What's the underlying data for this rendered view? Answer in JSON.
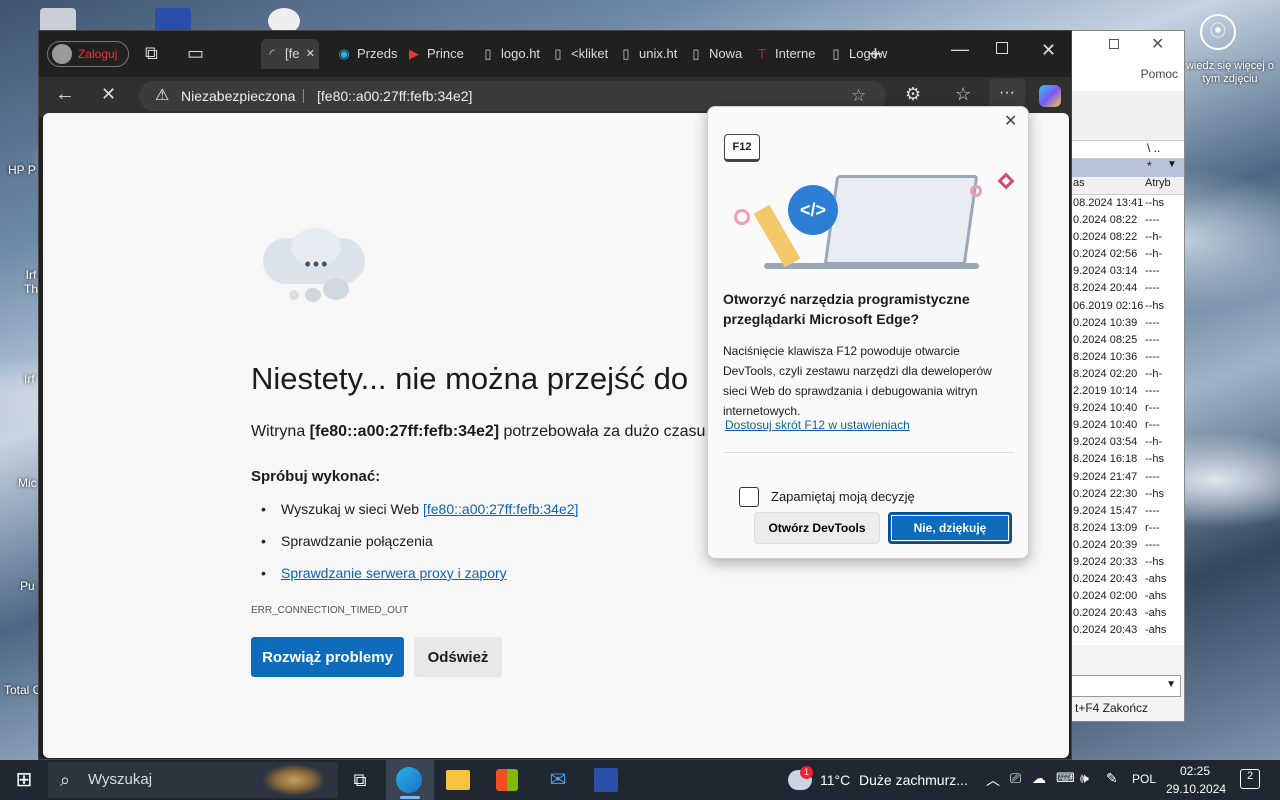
{
  "desktop": {
    "icons": [
      "HP P",
      "Irf Th",
      "Irf",
      "Mic",
      "Pu",
      "Total C"
    ],
    "overlay_text": "wiedz się więcej o tym zdjęciu"
  },
  "back_window": {
    "menu_help": "Pomoc",
    "path_hint": "\\ ..",
    "filter": "*",
    "col_date": "as",
    "col_attr": "Atryb",
    "rows": [
      {
        "date": "08.2024 13:41",
        "attr": "--hs"
      },
      {
        "date": "0.2024 08:22",
        "attr": "----"
      },
      {
        "date": "0.2024 08:22",
        "attr": "--h-"
      },
      {
        "date": "0.2024 02:56",
        "attr": "--h-"
      },
      {
        "date": "9.2024 03:14",
        "attr": "----"
      },
      {
        "date": "8.2024 20:44",
        "attr": "----"
      },
      {
        "date": "06.2019 02:16",
        "attr": "--hs"
      },
      {
        "date": "0.2024 10:39",
        "attr": "----"
      },
      {
        "date": "0.2024 08:25",
        "attr": "----"
      },
      {
        "date": "8.2024 10:36",
        "attr": "----"
      },
      {
        "date": "8.2024 02:20",
        "attr": "--h-"
      },
      {
        "date": "2.2019 10:14",
        "attr": "----"
      },
      {
        "date": "9.2024 10:40",
        "attr": "r---"
      },
      {
        "date": "9.2024 10:40",
        "attr": "r---"
      },
      {
        "date": "9.2024 03:54",
        "attr": "--h-"
      },
      {
        "date": "8.2024 16:18",
        "attr": "--hs"
      },
      {
        "date": "9.2024 21:47",
        "attr": "----"
      },
      {
        "date": "0.2024 22:30",
        "attr": "--hs"
      },
      {
        "date": "9.2024 15:47",
        "attr": "----"
      },
      {
        "date": "8.2024 13:09",
        "attr": "r---"
      },
      {
        "date": "0.2024 20:39",
        "attr": "----"
      },
      {
        "date": "9.2024 20:33",
        "attr": "--hs"
      },
      {
        "date": "0.2024 20:43",
        "attr": "-ahs"
      },
      {
        "date": "0.2024 02:00",
        "attr": "-ahs"
      },
      {
        "date": "0.2024 20:43",
        "attr": "-ahs"
      },
      {
        "date": "0.2024 20:43",
        "attr": "-ahs"
      }
    ],
    "footer": "t+F4 Zakończ"
  },
  "browser": {
    "profile": "Zaloguj",
    "tabs": [
      {
        "label": "[fe",
        "icon": "loading-icon"
      },
      {
        "label": "Przeds",
        "icon": "edge-icon"
      },
      {
        "label": "Prince",
        "icon": "youtube-icon"
      },
      {
        "label": "logo.ht",
        "icon": "page-icon"
      },
      {
        "label": "<kliket",
        "icon": "page-icon"
      },
      {
        "label": "unix.ht",
        "icon": "page-icon"
      },
      {
        "label": "Nowa",
        "icon": "page-icon"
      },
      {
        "label": "Interne",
        "icon": "t-icon"
      },
      {
        "label": "Logow",
        "icon": "page-icon"
      }
    ],
    "address": {
      "security": "Niezabezpieczona",
      "url": "[fe80::a00:27ff:fefb:34e2]"
    }
  },
  "error_page": {
    "title": "Niestety... nie można przejść do",
    "sub_prefix": "Witryna ",
    "sub_host": "[fe80::a00:27ff:fefb:34e2]",
    "sub_suffix": " potrzebowała za dużo czasu",
    "try_label": "Spróbuj wykonać:",
    "search_prefix": "Wyszukaj w sieci Web ",
    "search_link": "[fe80::a00:27ff:fefb:34e2]",
    "check_connection": "Sprawdzanie połączenia",
    "check_proxy": "Sprawdzanie serwera proxy i zapory",
    "code": "ERR_CONNECTION_TIMED_OUT",
    "fix_button": "Rozwiąż problemy",
    "refresh_button": "Odśwież"
  },
  "popup": {
    "key_badge": "F12",
    "title": "Otworzyć narzędzia programistyczne przeglądarki Microsoft Edge?",
    "body": "Naciśnięcie klawisza F12 powoduje otwarcie DevTools, czyli zestawu narzędzi dla deweloperów sieci Web do sprawdzania i debugowania witryn internetowych.",
    "settings_link": "Dostosuj skrót F12 w ustawieniach",
    "remember": "Zapamiętaj moją decyzję",
    "open_button": "Otwórz DevTools",
    "no_button": "Nie, dziękuję"
  },
  "taskbar": {
    "search_placeholder": "Wyszukaj",
    "weather_temp": "11°C",
    "weather_desc": "Duże zachmurz...",
    "weather_badge": "1",
    "language": "POL",
    "time": "02:25",
    "date": "29.10.2024",
    "notifications": "2"
  }
}
